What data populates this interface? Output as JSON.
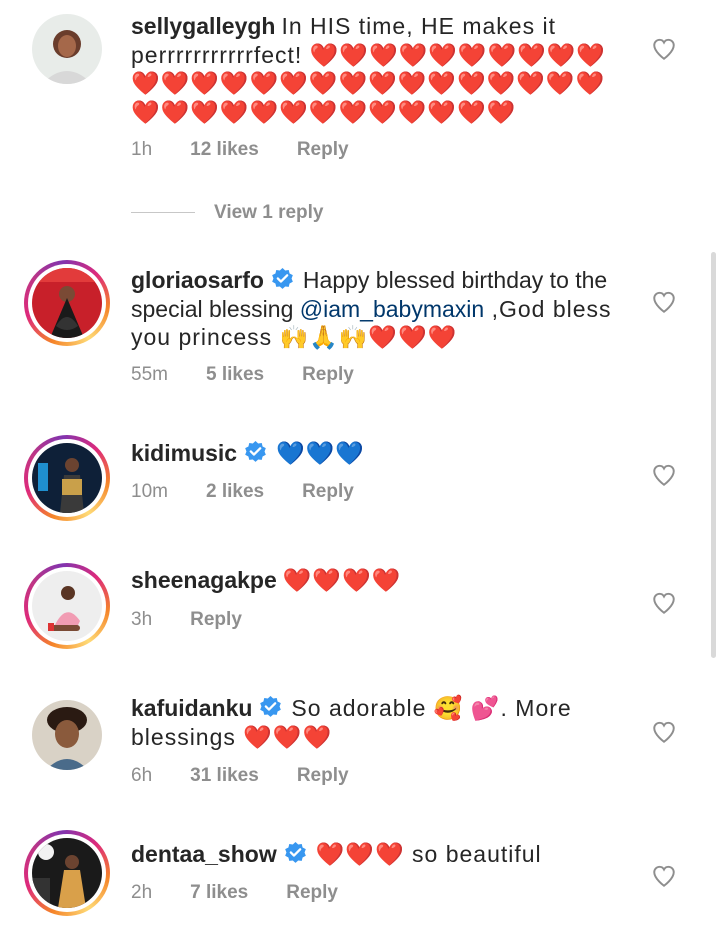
{
  "colors": {
    "text": "#262626",
    "muted": "#8e8e8e",
    "mention": "#00376b",
    "verified": "#3897f0"
  },
  "view_replies": {
    "label": "View 1 reply"
  },
  "comments": [
    {
      "username": "sellygalleygh",
      "verified": false,
      "text": "In HIS time, HE makes it perrrrrrrrrrrfect! ❤️❤️❤️❤️❤️❤️❤️❤️❤️❤️❤️❤️❤️❤️❤️❤️❤️❤️❤️❤️❤️❤️❤️❤️❤️❤️❤️❤️❤️❤️❤️❤️❤️❤️❤️❤️❤️❤️❤️",
      "time": "1h",
      "likes": "12 likes",
      "reply": "Reply"
    },
    {
      "username": "gloriaosarfo",
      "verified": true,
      "text_before": "Happy blessed birthday to the special blessing ",
      "mention": "@iam_babymaxin",
      "text_after": " ,God bless you princess 🙌🙏🙌❤️❤️❤️",
      "time": "55m",
      "likes": "5 likes",
      "reply": "Reply"
    },
    {
      "username": "kidimusic",
      "verified": true,
      "text": "💙💙💙",
      "time": "10m",
      "likes": "2 likes",
      "reply": "Reply"
    },
    {
      "username": "sheenagakpe",
      "verified": false,
      "text": "❤️❤️❤️❤️",
      "time": "3h",
      "reply": "Reply"
    },
    {
      "username": "kafuidanku",
      "verified": true,
      "text": "So adorable 🥰 💕. More blessings ❤️❤️❤️",
      "time": "6h",
      "likes": "31 likes",
      "reply": "Reply"
    },
    {
      "username": "dentaa_show",
      "verified": true,
      "text": "❤️❤️❤️ so beautiful",
      "time": "2h",
      "likes": "7 likes",
      "reply": "Reply"
    }
  ]
}
